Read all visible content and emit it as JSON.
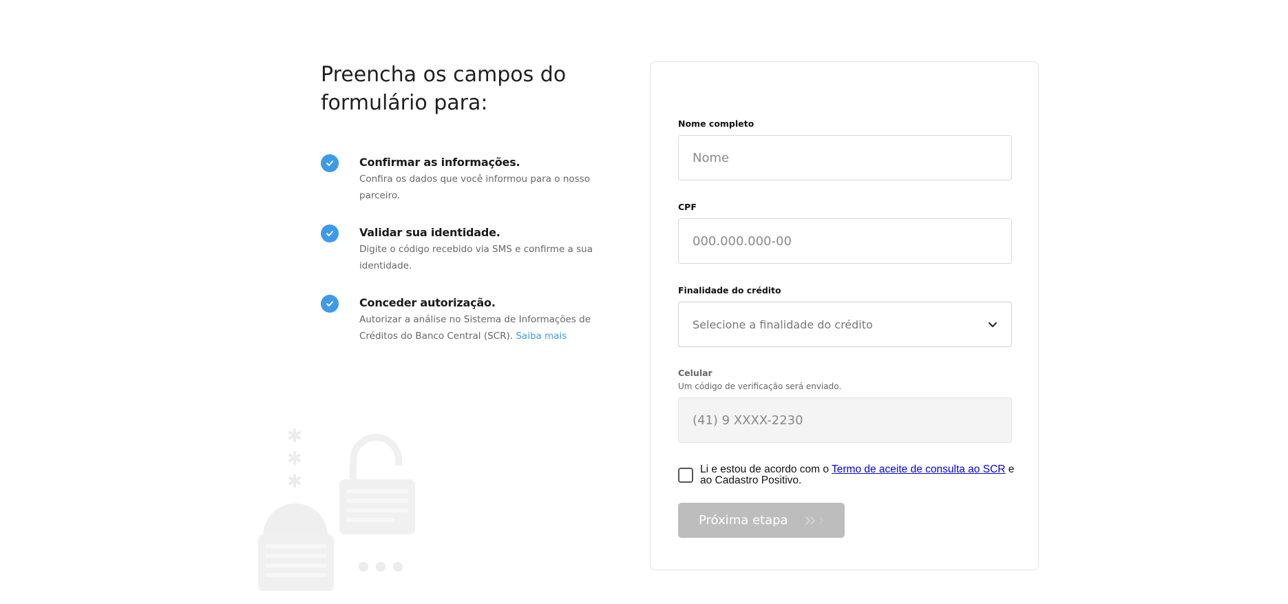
{
  "intro": {
    "heading_line1": "Preencha os campos do",
    "heading_line2": "formulário para:",
    "steps": [
      {
        "title": "Confirmar as informações.",
        "description": "Confira os dados que você informou para o nosso parceiro."
      },
      {
        "title": "Validar sua identidade.",
        "description": "Digite o código recebido via SMS e confirme a sua identidade."
      },
      {
        "title": "Conceder autorização.",
        "description": "Autorizar a análise no Sistema de Informações de Créditos do Banco Central (SCR).",
        "link": "Saiba mais"
      }
    ]
  },
  "form": {
    "name": {
      "label": "Nome completo",
      "placeholder": "Nome",
      "value": ""
    },
    "cpf": {
      "label": "CPF",
      "placeholder": "000.000.000-00",
      "value": ""
    },
    "purpose": {
      "label": "Finalidade do crédito",
      "selected": "Selecione a finalidade do crédito"
    },
    "phone": {
      "label": "Celular",
      "hint": "Um código de verificação será enviado.",
      "value": "(41) 9 XXXX-2230"
    },
    "terms": {
      "prefix": "Li e estou de acordo com o ",
      "link": "Termo de aceite de consulta ao SCR",
      "suffix": " e ao Cadastro Positivo.",
      "checked": false
    },
    "submit_label": "Próxima etapa"
  },
  "colors": {
    "accent": "#3d9ae8",
    "button_disabled": "#bdbdbd",
    "illustration": "#f2f2f2"
  },
  "icons": {
    "step": "check-circle-icon",
    "select": "chevron-down-icon",
    "button": "double-chevron-right-icon"
  }
}
